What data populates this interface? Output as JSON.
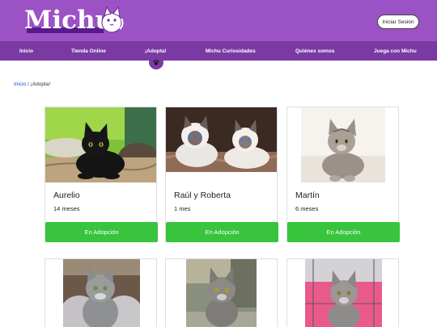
{
  "header": {
    "logo_text": "Michu",
    "login_label": "Iniciar Sesión"
  },
  "nav": {
    "items": [
      {
        "label": "Inicio"
      },
      {
        "label": "Tienda Online"
      },
      {
        "label": "¡Adopta!"
      },
      {
        "label": "Michu Curiosidades"
      },
      {
        "label": "Quiénes somos"
      },
      {
        "label": "Juega con Michu"
      }
    ],
    "active_icon": "paw-icon"
  },
  "breadcrumb": {
    "home": "Inicio",
    "separator": "/",
    "current": "¡Adopta!"
  },
  "cards": [
    {
      "name": "Aurelio",
      "age": "14 meses",
      "button": "En Adopción"
    },
    {
      "name": "Raúl y Roberta",
      "age": "1 mes",
      "button": "En Adopción"
    },
    {
      "name": "Martín",
      "age": "6 meses",
      "button": "En Adopción"
    }
  ],
  "colors": {
    "header": "#9b52c4",
    "nav": "#7b3aa3",
    "button": "#38c43c",
    "link": "#1a4fd0"
  }
}
